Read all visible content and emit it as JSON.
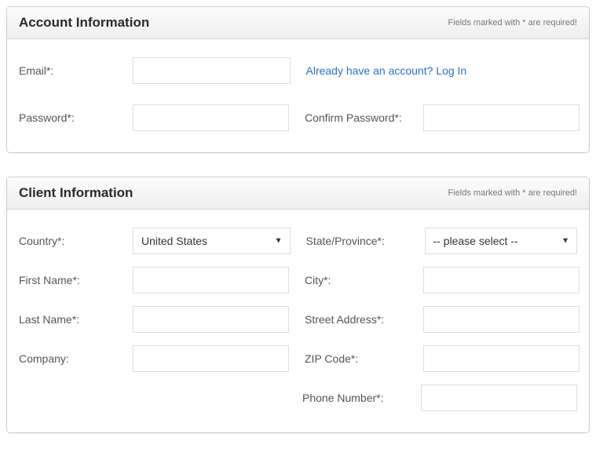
{
  "account": {
    "title": "Account Information",
    "note": "Fields marked with * are required!",
    "login_text": "Already have an account? Log In",
    "fields": {
      "email_label": "Email*:",
      "email_value": "",
      "password_label": "Password*:",
      "password_value": "",
      "confirm_label": "Confirm Password*:",
      "confirm_value": ""
    }
  },
  "client": {
    "title": "Client Information",
    "note": "Fields marked with * are required!",
    "fields": {
      "country_label": "Country*:",
      "country_value": "United States",
      "state_label": "State/Province*:",
      "state_placeholder": "-- please select --",
      "first_name_label": "First Name*:",
      "first_name_value": "",
      "city_label": "City*:",
      "city_value": "",
      "last_name_label": "Last Name*:",
      "last_name_value": "",
      "street_label": "Street Address*:",
      "street_value": "",
      "company_label": "Company:",
      "company_value": "",
      "zip_label": "ZIP Code*:",
      "zip_value": "",
      "phone_label": "Phone Number*:",
      "phone_value": ""
    }
  }
}
